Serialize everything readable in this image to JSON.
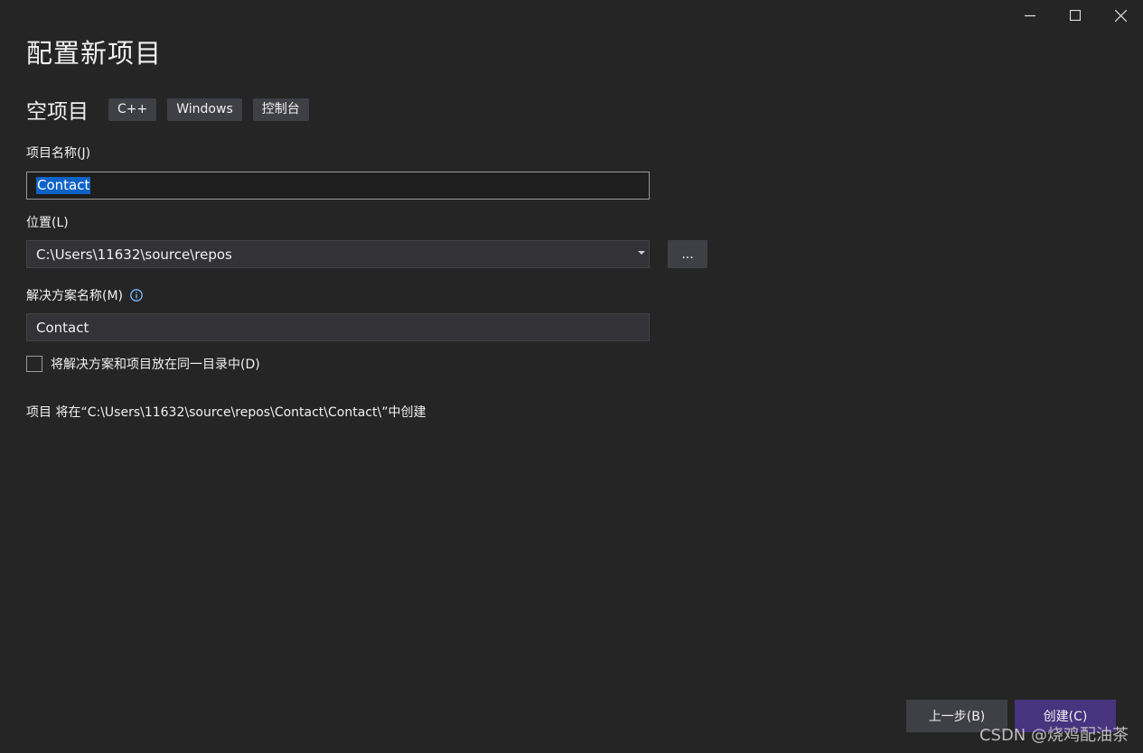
{
  "window": {
    "title": "配置新项目",
    "controls": [
      "minimize-icon",
      "maximize-icon",
      "close-icon"
    ]
  },
  "template": {
    "name": "空项目",
    "tags": [
      "C++",
      "Windows",
      "控制台"
    ]
  },
  "project_name": {
    "label": "项目名称(J)",
    "value": "Contact"
  },
  "location": {
    "label": "位置(L)",
    "value": "C:\\Users\\11632\\source\\repos",
    "browse_label": "..."
  },
  "solution_name": {
    "label": "解决方案名称(M)",
    "value": "Contact",
    "info_icon": "info-icon"
  },
  "same_directory": {
    "label": "将解决方案和项目放在同一目录中(D)",
    "checked": false
  },
  "path_info": "项目 将在“C:\\Users\\11632\\source\\repos\\Contact\\Contact\\”中创建",
  "buttons": {
    "back": "上一步(B)",
    "create": "创建(C)"
  },
  "watermark": "CSDN @烧鸡配油茶",
  "colors": {
    "background": "#252526",
    "create_button": "#48337f",
    "selection": "#0e63c6",
    "info_icon": "#75beff"
  }
}
